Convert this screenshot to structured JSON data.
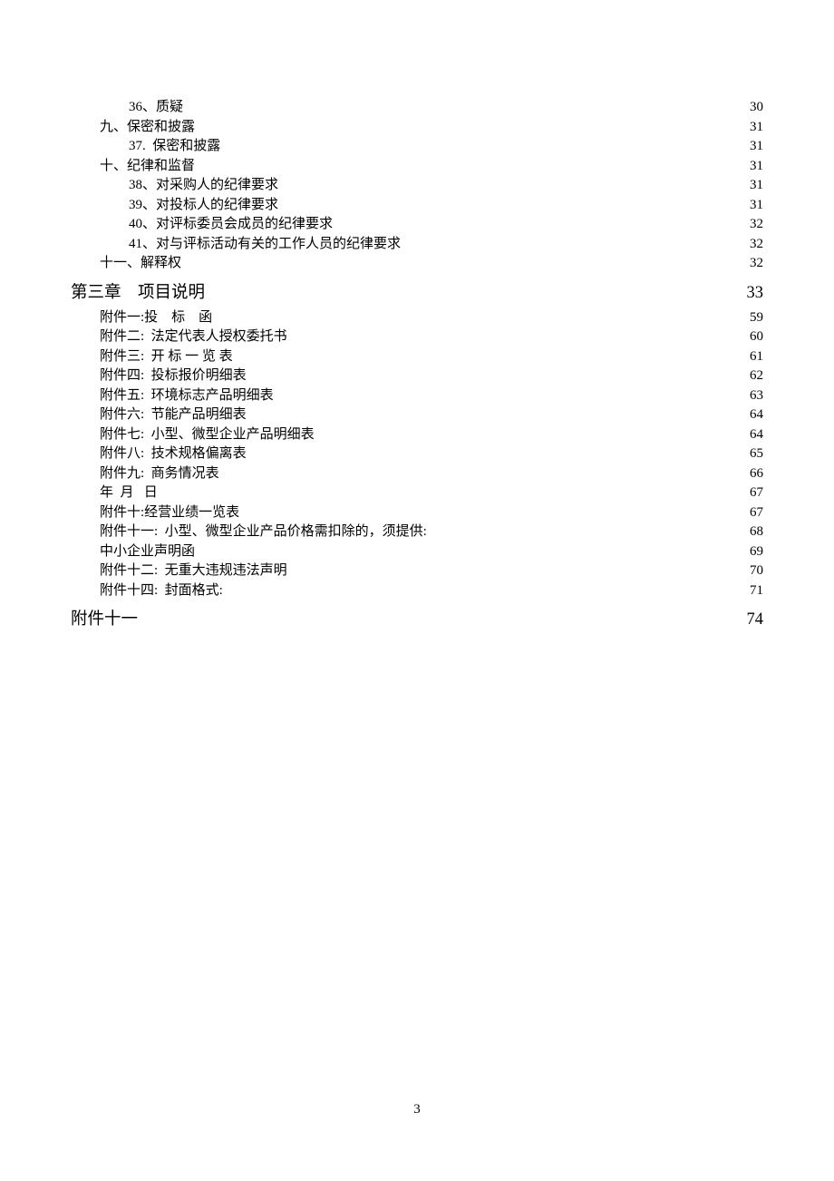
{
  "toc": [
    {
      "indent": 2,
      "label": "36、质疑",
      "page": "30",
      "type": "item"
    },
    {
      "indent": 1,
      "label": "九、保密和披露",
      "page": "31",
      "type": "item"
    },
    {
      "indent": 2,
      "label": "37.  保密和披露",
      "page": "31",
      "type": "item"
    },
    {
      "indent": 1,
      "label": "十、纪律和监督",
      "page": "31",
      "type": "item"
    },
    {
      "indent": 2,
      "label": "38、对采购人的纪律要求",
      "page": "31",
      "type": "item"
    },
    {
      "indent": 2,
      "label": "39、对投标人的纪律要求",
      "page": "31",
      "type": "item"
    },
    {
      "indent": 2,
      "label": "40、对评标委员会成员的纪律要求",
      "page": "32",
      "type": "item"
    },
    {
      "indent": 2,
      "label": "41、对与评标活动有关的工作人员的纪律要求",
      "page": "32",
      "type": "item"
    },
    {
      "indent": 1,
      "label": "十一、解释权",
      "page": "32",
      "type": "item"
    },
    {
      "indent": 0,
      "label": "第三章    项目说明",
      "page": "33",
      "type": "chapter"
    },
    {
      "indent": 1,
      "label": "附件一:投    标    函",
      "page": "59",
      "type": "item"
    },
    {
      "indent": 1,
      "label": "附件二:  法定代表人授权委托书",
      "page": "60",
      "type": "item"
    },
    {
      "indent": 1,
      "label": "附件三:  开 标 一 览 表",
      "page": "61",
      "type": "item"
    },
    {
      "indent": 1,
      "label": "附件四:  投标报价明细表",
      "page": "62",
      "type": "item"
    },
    {
      "indent": 1,
      "label": "附件五:  环境标志产品明细表",
      "page": "63",
      "type": "item"
    },
    {
      "indent": 1,
      "label": "附件六:  节能产品明细表",
      "page": "64",
      "type": "item"
    },
    {
      "indent": 1,
      "label": "附件七:  小型、微型企业产品明细表",
      "page": "64",
      "type": "item"
    },
    {
      "indent": 1,
      "label": "附件八:  技术规格偏离表",
      "page": "65",
      "type": "item"
    },
    {
      "indent": 1,
      "label": "附件九:  商务情况表",
      "page": "66",
      "type": "item"
    },
    {
      "indent": 1,
      "label": "年  月   日",
      "page": "67",
      "type": "item"
    },
    {
      "indent": 1,
      "label": "附件十:经营业绩一览表",
      "page": "67",
      "type": "item"
    },
    {
      "indent": 1,
      "label": "附件十一:  小型、微型企业产品价格需扣除的，须提供:",
      "page": "68",
      "type": "item"
    },
    {
      "indent": 1,
      "label": "中小企业声明函",
      "page": "69",
      "type": "item"
    },
    {
      "indent": 1,
      "label": "附件十二:  无重大违规违法声明",
      "page": "70",
      "type": "item"
    },
    {
      "indent": 1,
      "label": "附件十四:  封面格式:",
      "page": "71",
      "type": "item"
    },
    {
      "indent": 0,
      "label": "附件十一",
      "page": "74",
      "type": "chapter"
    }
  ],
  "pageNumber": "3"
}
